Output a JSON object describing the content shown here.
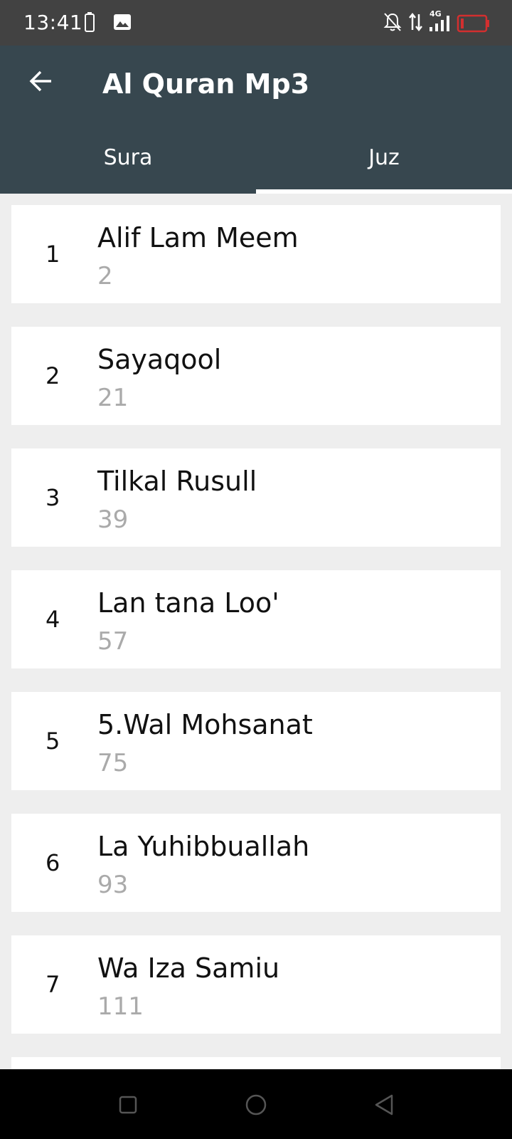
{
  "status_bar": {
    "time": "13:41",
    "icons": [
      "battery-icon",
      "image-icon",
      "bell-off-icon",
      "data-arrows-icon",
      "signal-4g-icon",
      "battery-low-icon"
    ],
    "network_label": "4G"
  },
  "app_bar": {
    "title": "Al Quran Mp3",
    "back_icon": "arrow-back-icon"
  },
  "tabs": [
    {
      "label": "Sura",
      "active": false
    },
    {
      "label": "Juz",
      "active": true
    }
  ],
  "juz_list": [
    {
      "number": "1",
      "name": "Alif Lam Meem",
      "page": "2"
    },
    {
      "number": "2",
      "name": "Sayaqool",
      "page": "21"
    },
    {
      "number": "3",
      "name": "Tilkal Rusull",
      "page": "39"
    },
    {
      "number": "4",
      "name": "Lan tana Loo'",
      "page": "57"
    },
    {
      "number": "5",
      "name": "5.Wal Mohsanat",
      "page": "75"
    },
    {
      "number": "6",
      "name": "La Yuhibbuallah",
      "page": "93"
    },
    {
      "number": "7",
      "name": "Wa Iza Samiu",
      "page": "111"
    }
  ],
  "nav_bar": {
    "buttons": [
      "recents-square-icon",
      "home-circle-icon",
      "back-triangle-icon"
    ]
  },
  "colors": {
    "status_bar": "#424242",
    "app_bar": "#37474f",
    "background": "#eeeeee",
    "card": "#ffffff",
    "subtitle_text": "#aaaaaa",
    "battery_low": "#d32f2f"
  }
}
